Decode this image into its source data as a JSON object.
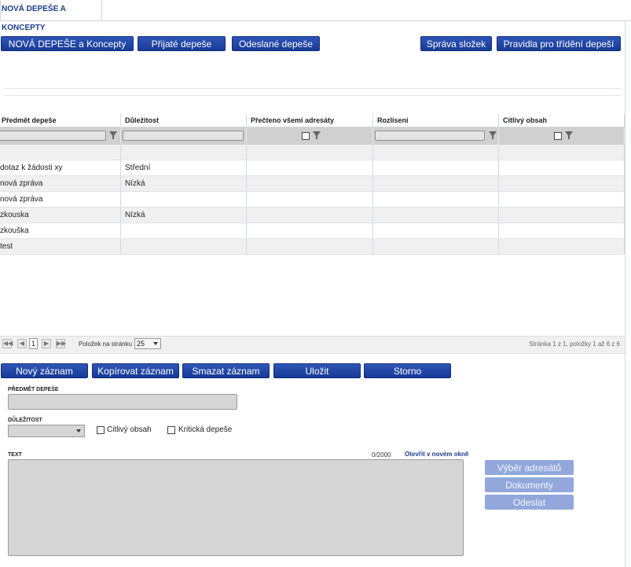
{
  "tab": {
    "label": "NOVÁ DEPEŠE A KONCEPTY"
  },
  "toolbar": {
    "new_label": "NOVÁ DEPEŠE a Koncepty",
    "received_label": "Přijaté depeše",
    "sent_label": "Odeslané depeše",
    "folders_label": "Správa složek",
    "rules_label": "Pravidla pro třídění depeší"
  },
  "grid": {
    "columns": [
      "Předmět depeše",
      "Důležitost",
      "Přečteno všemi adresáty",
      "Rozliseni",
      "Citlivý obsah"
    ],
    "rows": [
      [
        "",
        "",
        "",
        "",
        ""
      ],
      [
        "dotaz k žádosti xy",
        "Střední",
        "",
        "",
        ""
      ],
      [
        "nová zpráva",
        "Nízká",
        "",
        "",
        ""
      ],
      [
        "nová zpráva",
        "",
        "",
        "",
        ""
      ],
      [
        "zkouska",
        "Nízká",
        "",
        "",
        ""
      ],
      [
        "zkouška",
        "",
        "",
        "",
        ""
      ],
      [
        "test",
        "",
        "",
        "",
        ""
      ]
    ]
  },
  "pager": {
    "first": "◀◀",
    "prev": "◀",
    "next": "▶",
    "last": "▶▶",
    "page": "1",
    "page_size_label": "Položek na stránku",
    "page_size": "25",
    "info": "Stránka 1 z 1, položky 1 až 6 z 6"
  },
  "actions": {
    "new_record": "Nový záznam",
    "copy_record": "Kopírovat záznam",
    "delete_record": "Smazat záznam",
    "save": "Uložit",
    "cancel": "Storno"
  },
  "form": {
    "subject_label": "PŘEDMĚT DEPEŠE",
    "priority_label": "DŮLEŽITOST",
    "sensitive_label": "Citlivý obsah",
    "critical_label": "Kritická depeše",
    "text_label": "TEXT",
    "counter": "0/2000",
    "open_new_window": "Otevřít v novém okně"
  },
  "side_buttons": {
    "recipients": "Výběr adresátů",
    "documents": "Dokumenty",
    "send": "Odeslat"
  }
}
